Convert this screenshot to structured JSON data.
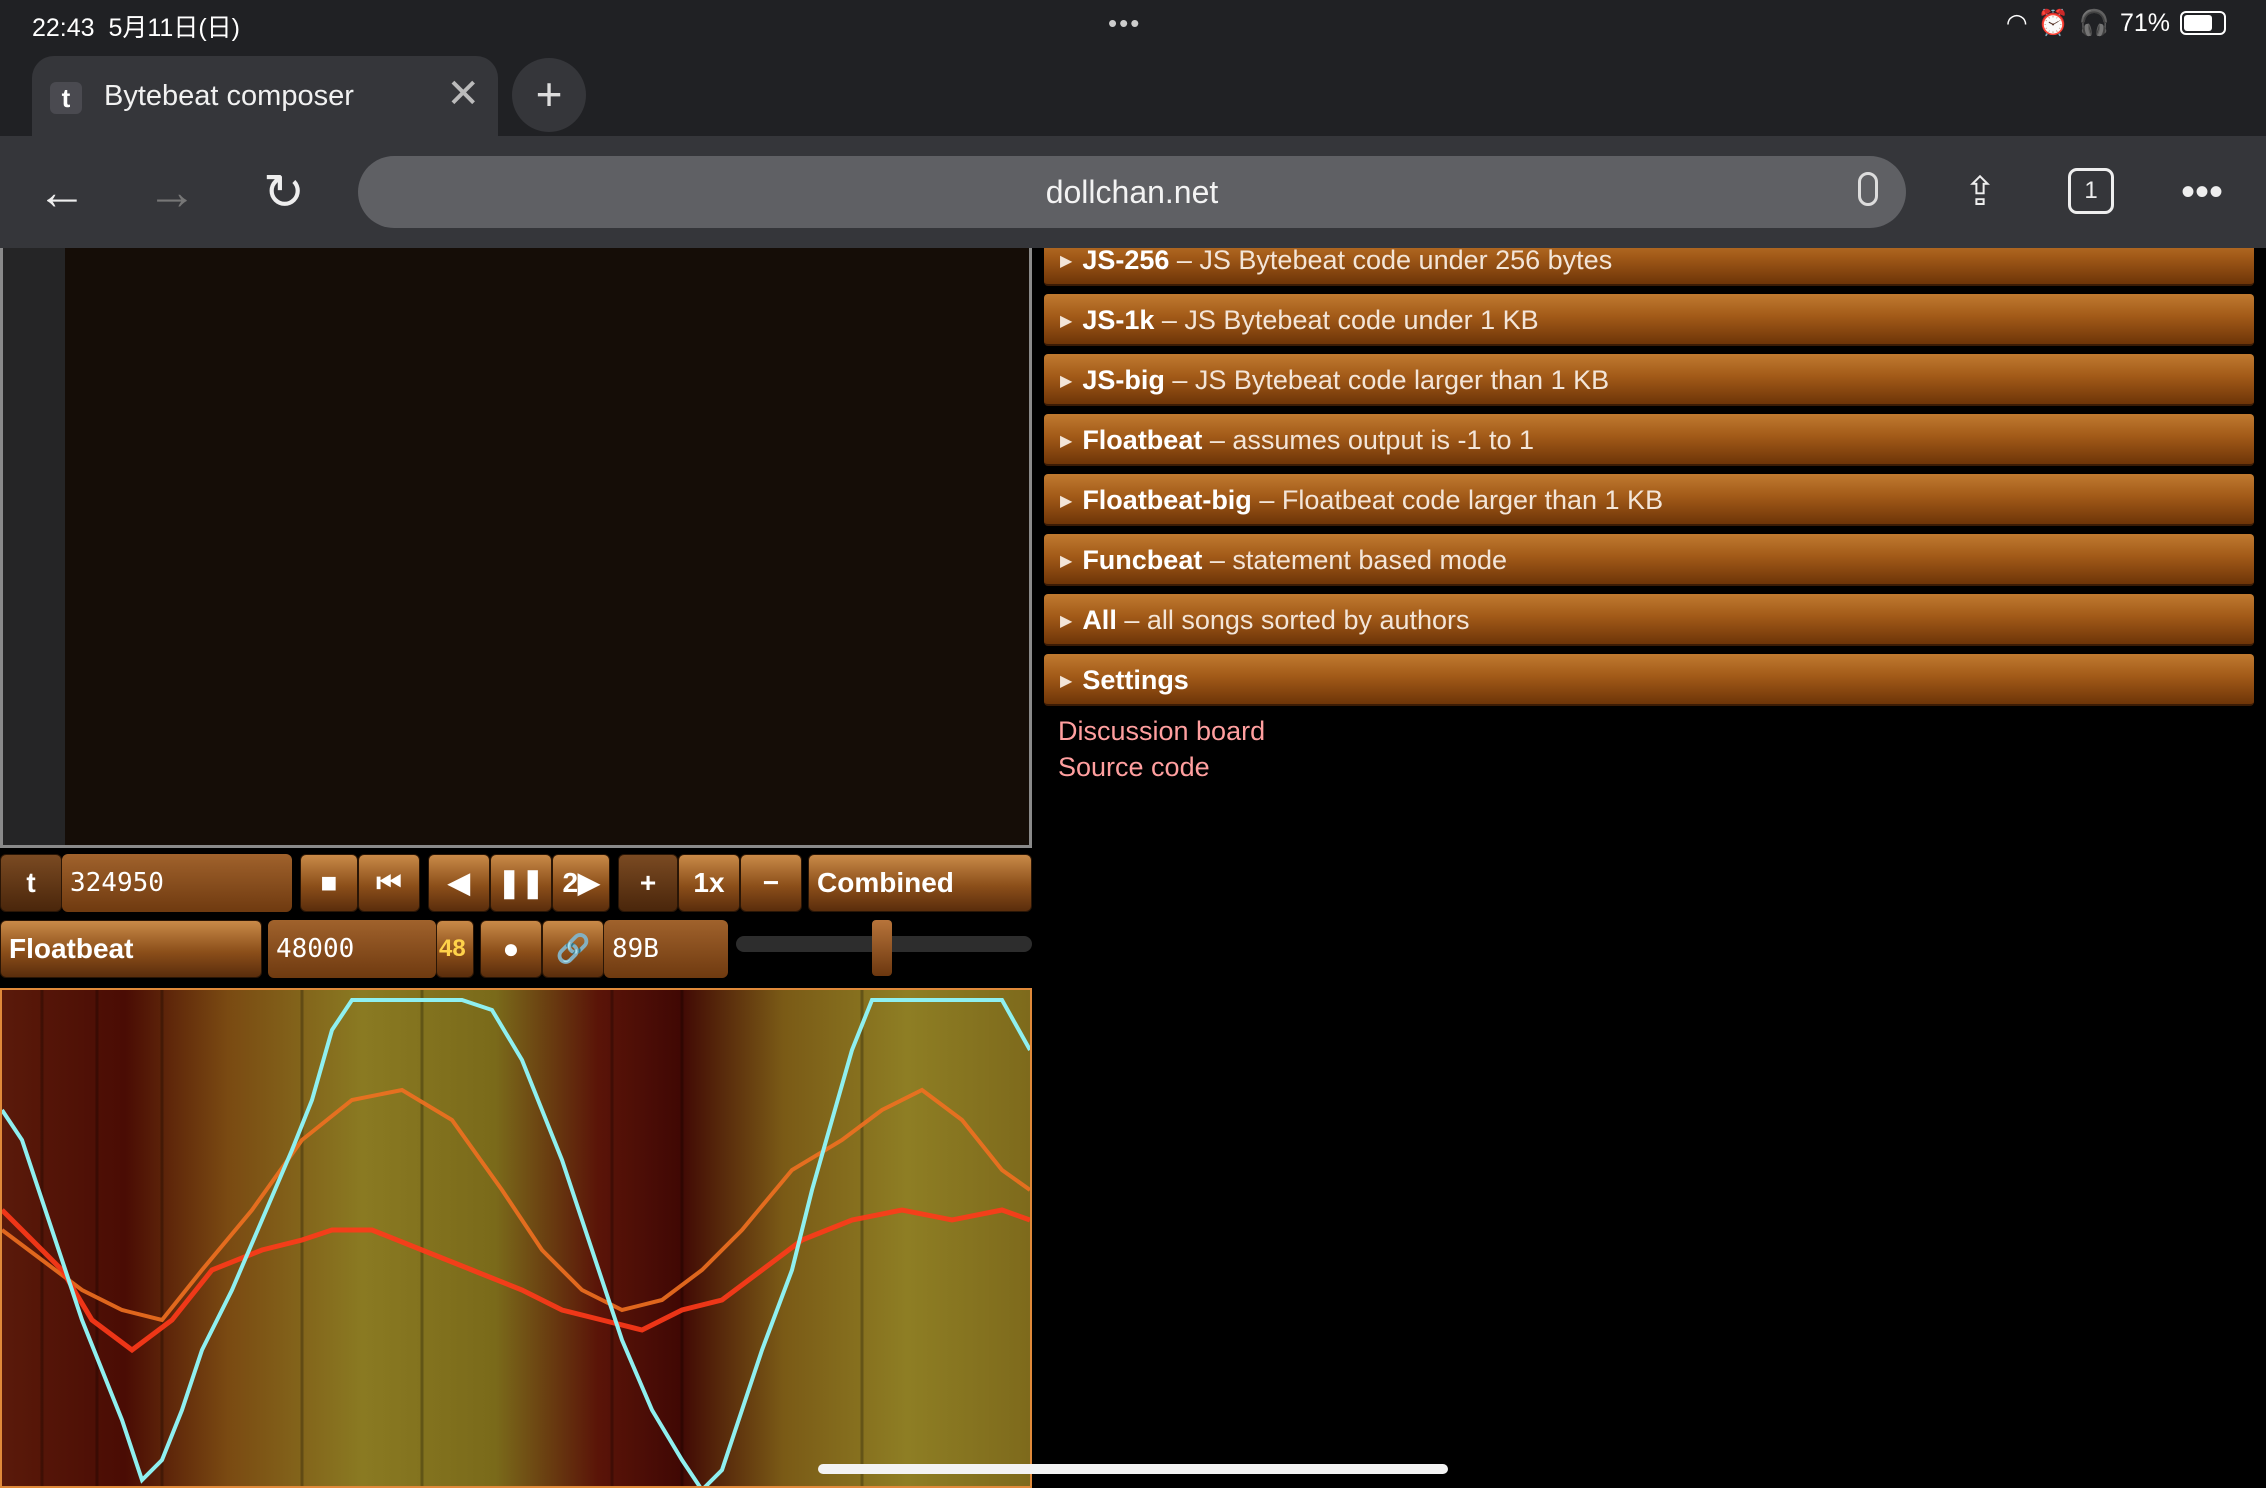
{
  "status_bar": {
    "time": "22:43",
    "date": "5月11日(日)",
    "dots": "•••",
    "battery": "71%",
    "battery_level": 0.71
  },
  "browser": {
    "tab_title": "Bytebeat composer",
    "url": "dollchan.net",
    "tab_count": "1"
  },
  "controls": {
    "t_label": "t",
    "t_value": "324950",
    "speed_label": "2",
    "rate_label": "1x",
    "mode_label": "Combined",
    "type_label": "Floatbeat",
    "sample_rate": "48000",
    "sample_rate_overflow": "48",
    "size_label": "89B",
    "volume_level": 0.5
  },
  "library": {
    "sections": [
      {
        "name": "JS-256",
        "desc": " – JS Bytebeat code under 256 bytes"
      },
      {
        "name": "JS-1k",
        "desc": " – JS Bytebeat code under 1 KB"
      },
      {
        "name": "JS-big",
        "desc": " – JS Bytebeat code larger than 1 KB"
      },
      {
        "name": "Floatbeat",
        "desc": " – assumes output is -1 to 1"
      },
      {
        "name": "Floatbeat-big",
        "desc": " – Floatbeat code larger than 1 KB"
      },
      {
        "name": "Funcbeat",
        "desc": " – statement based mode"
      },
      {
        "name": "All",
        "desc": " – all songs sorted by authors"
      },
      {
        "name": "Settings",
        "desc": ""
      }
    ],
    "links": [
      "Discussion board",
      "Source code"
    ]
  }
}
